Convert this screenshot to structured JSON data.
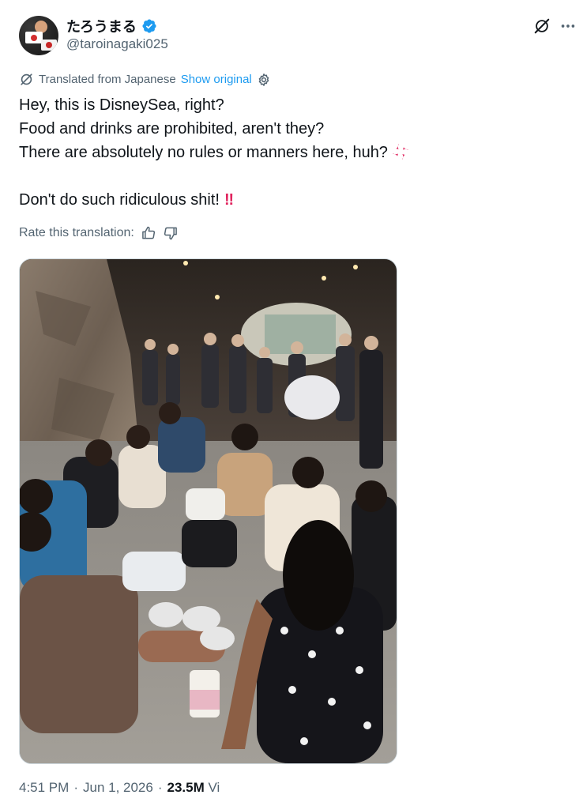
{
  "author": {
    "display_name": "たろうまる",
    "handle": "@taroinagaki025",
    "verified": true
  },
  "header": {
    "grok_icon": "grok-icon",
    "more_icon": "more-icon"
  },
  "translation": {
    "label": "Translated from Japanese",
    "show_original": "Show original"
  },
  "tweet": {
    "lines": [
      "Hey, this is DisneySea, right?",
      "Food and drinks are prohibited, aren't they?",
      "There are absolutely no rules or manners here, huh?",
      "Don't do such ridiculous shit!"
    ],
    "emoji_anger": "anger-symbol-icon",
    "emoji_bang": "‼"
  },
  "rate": {
    "label": "Rate this translation:"
  },
  "footer": {
    "time": "4:51 PM",
    "date": "Jun 1, 2026",
    "views_count": "23.5M",
    "views_label": "Vi"
  },
  "colors": {
    "link": "#1d9bf0",
    "secondary_text": "#536471",
    "verified": "#1d9bf0",
    "anger": "#e0245e"
  }
}
